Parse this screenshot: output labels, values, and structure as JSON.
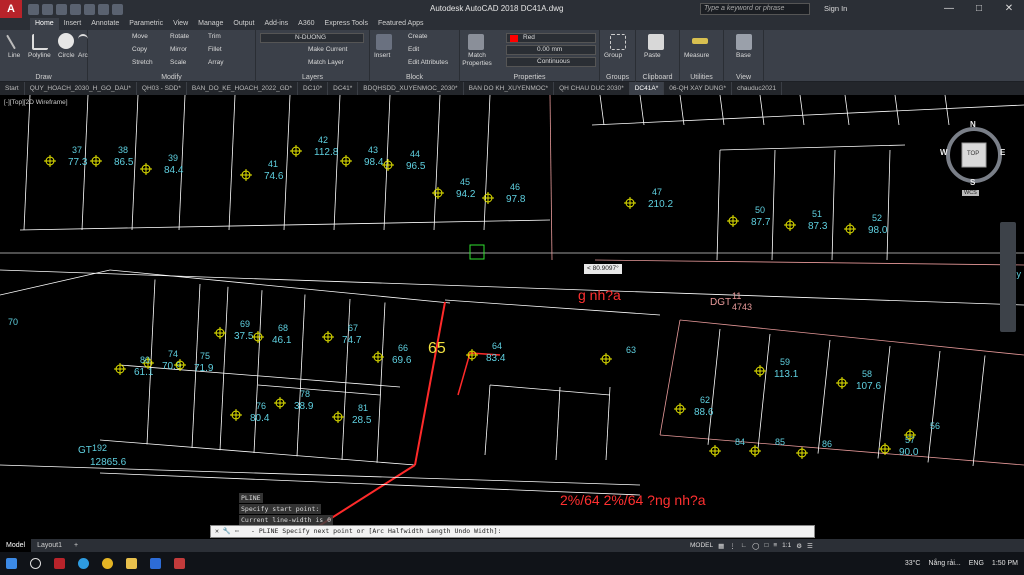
{
  "app": {
    "title": "Autodesk AutoCAD 2018    DC41A.dwg",
    "search_placeholder": "Type a keyword or phrase",
    "sign_in": "Sign In",
    "layer_name": "N-DUONG"
  },
  "ribbon_tabs": [
    "Home",
    "Insert",
    "Annotate",
    "Parametric",
    "View",
    "Manage",
    "Output",
    "Add-ins",
    "A360",
    "Express Tools",
    "Featured Apps"
  ],
  "ribbon": {
    "draw": {
      "label": "Draw",
      "line": "Line",
      "polyline": "Polyline",
      "circle": "Circle",
      "arc": "Arc"
    },
    "modify": {
      "label": "Modify",
      "move": "Move",
      "rotate": "Rotate",
      "trim": "Trim",
      "copy": "Copy",
      "mirror": "Mirror",
      "fillet": "Fillet",
      "stretch": "Stretch",
      "scale": "Scale",
      "array": "Array"
    },
    "layers": {
      "label": "Layers",
      "layer": "N-DUONG",
      "make_current": "Make Current",
      "match_layer": "Match Layer"
    },
    "block": {
      "label": "Block",
      "insert": "Insert",
      "create": "Create",
      "edit": "Edit",
      "edit_attributes": "Edit Attributes"
    },
    "properties": {
      "label": "Properties",
      "match": "Match Properties",
      "color": "Red",
      "lineweight": "0.00 mm",
      "linetype": "Continuous"
    },
    "groups": {
      "label": "Groups",
      "group": "Group"
    },
    "clipboard": {
      "label": "Clipboard",
      "paste": "Paste"
    },
    "utilities": {
      "label": "Utilities",
      "measure": "Measure"
    },
    "view": {
      "label": "View",
      "base": "Base"
    }
  },
  "doc_tabs": [
    "Start",
    "QUY_HOACH_2030_H_GO_DAU*",
    "QH03 - SDD*",
    "BAN_DO_KE_HOACH_2022_GD*",
    "DC10*",
    "DC41*",
    "BDQHSDD_XUYENMOC_2030*",
    "BAN DO KH_XUYENMOC*",
    "QH CHAU DUC 2030*",
    "DC41A*",
    "06-QH XAY DUNG*",
    "chauduc2021"
  ],
  "active_doc_tab": "DC41A*",
  "viewport_label": "[-][Top][2D Wireframe]",
  "viewcube": {
    "top": "TOP",
    "n": "N",
    "s": "S",
    "e": "E",
    "w": "W",
    "wcs": "WCS"
  },
  "tooltip": "< 80.9097°",
  "parcels_top": [
    {
      "num": "37",
      "area": "77.3"
    },
    {
      "num": "38",
      "area": "86.5"
    },
    {
      "num": "39",
      "area": "84.4"
    },
    {
      "num": "41",
      "area": "74.6"
    },
    {
      "num": "42",
      "area": "112.8"
    },
    {
      "num": "43",
      "area": "98.4"
    },
    {
      "num": "44",
      "area": "96.5"
    },
    {
      "num": "45",
      "area": "94.2"
    },
    {
      "num": "46",
      "area": "97.8"
    },
    {
      "num": "47",
      "area": "210.2"
    },
    {
      "num": "50",
      "area": "87.7"
    },
    {
      "num": "51",
      "area": "87.3"
    },
    {
      "num": "52",
      "area": "98.0"
    }
  ],
  "parcels_bottom": [
    {
      "num": "70",
      "area": ""
    },
    {
      "num": "74",
      "area": "70.9"
    },
    {
      "num": "75",
      "area": "71.9"
    },
    {
      "num": "80",
      "area": "61.1"
    },
    {
      "num": "69",
      "area": "37.5"
    },
    {
      "num": "68",
      "area": "46.1"
    },
    {
      "num": "67",
      "area": "74.7"
    },
    {
      "num": "66",
      "area": "69.6"
    },
    {
      "num": "64",
      "area": "83.4"
    },
    {
      "num": "63",
      "area": ""
    },
    {
      "num": "59",
      "area": "113.1"
    },
    {
      "num": "58",
      "area": "107.6"
    },
    {
      "num": "57",
      "area": "90.0"
    },
    {
      "num": "62",
      "area": "88.6"
    },
    {
      "num": "76",
      "area": "80.4"
    },
    {
      "num": "78",
      "area": "38.9"
    },
    {
      "num": "81",
      "area": "28.5"
    },
    {
      "num": "84",
      "area": ""
    },
    {
      "num": "85",
      "area": ""
    },
    {
      "num": "86",
      "area": ""
    },
    {
      "num": "56",
      "area": ""
    }
  ],
  "big_parcel": {
    "code": "GT",
    "num": "192",
    "area": "12865.6"
  },
  "dgt": {
    "code": "DGT",
    "num": "11",
    "area": "4743"
  },
  "highlight_label": "65",
  "red_text_1": "g nh?a",
  "red_text_2": "2%/64 2%/64 ?ng nh?a",
  "side_text": "Nguy",
  "cmd_history": [
    "PLINE",
    "Specify start point:",
    "Current line-width is 0"
  ],
  "cmd_prompt": "- PLINE Specify next point or [Arc Halfwidth Length Undo Width]:",
  "layout_tabs": [
    "Model",
    "Layout1"
  ],
  "status": {
    "model": "MODEL",
    "scale": "1:1"
  },
  "tray": {
    "temp": "33°C",
    "weather": "Nắng rải...",
    "lang": "ENG",
    "time": "1:50 PM"
  }
}
